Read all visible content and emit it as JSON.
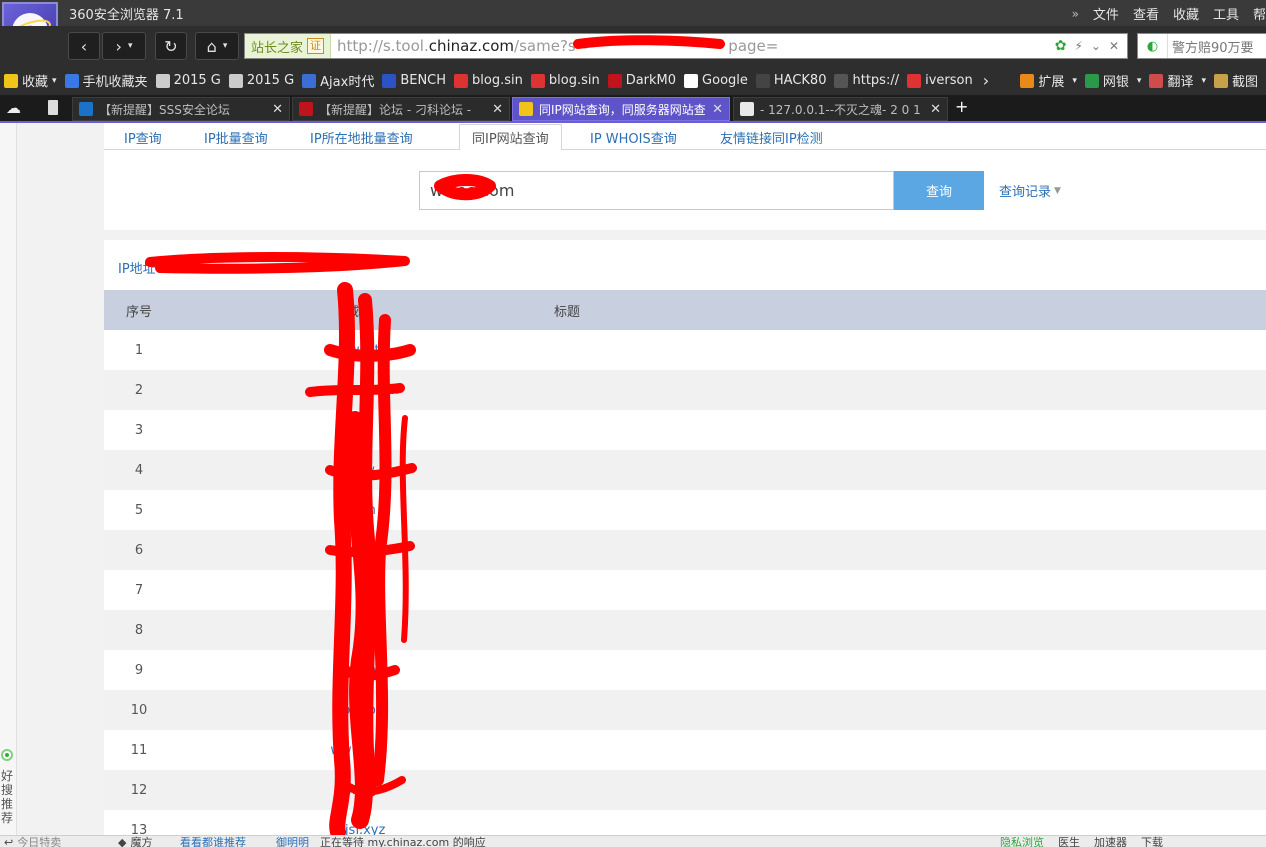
{
  "window": {
    "title": "360安全浏览器 7.1",
    "menu": [
      "文件",
      "查看",
      "收藏",
      "工具",
      "帮"
    ],
    "menu_chevron": "»"
  },
  "nav": {
    "site_badge": "站长之家",
    "site_badge_cert": "证",
    "url_prefix": "http://s.tool.",
    "url_host": "chinaz.com",
    "url_path": "/same?s=",
    "url_tail": "page=",
    "search_placeholder": "警方赔90万要"
  },
  "bookmarks": [
    {
      "label": "收藏",
      "icon": "star-icon"
    },
    {
      "label": "手机收藏夹",
      "icon": "phone-icon"
    },
    {
      "label": "2015 G",
      "icon": "l-icon"
    },
    {
      "label": "2015 G",
      "icon": "l-icon"
    },
    {
      "label": "Ajax时代",
      "icon": "ajax-icon"
    },
    {
      "label": "BENCH",
      "icon": "paw-icon"
    },
    {
      "label": "blog.sin",
      "icon": "blog-icon"
    },
    {
      "label": "blog.sin",
      "icon": "blog-icon"
    },
    {
      "label": "DarkM0",
      "icon": "skull-icon"
    },
    {
      "label": "Google",
      "icon": "google-icon"
    },
    {
      "label": "HACK80",
      "icon": "shield-icon"
    },
    {
      "label": "https://",
      "icon": "github-icon"
    },
    {
      "label": "iverson",
      "icon": "slc-icon"
    }
  ],
  "bookmarks_right": [
    {
      "label": "扩展",
      "icon": "puzzle-icon"
    },
    {
      "label": "网银",
      "icon": "bank-icon"
    },
    {
      "label": "翻译",
      "icon": "translate-icon"
    },
    {
      "label": "截图",
      "icon": "scissors-icon"
    }
  ],
  "tabs": [
    {
      "label": "【新提醒】SSS安全论坛",
      "icon": "sss-icon",
      "active": false
    },
    {
      "label": "【新提醒】论坛 - 刁科论坛 -",
      "icon": "slc-icon",
      "active": false
    },
    {
      "label": "同IP网站查询，同服务器网站查",
      "icon": "chinaz-icon",
      "active": true
    },
    {
      "label": "- 127.0.0.1--不灭之魂- 2 0 1",
      "icon": "page-icon",
      "active": false
    }
  ],
  "tool_tabs": [
    "IP查询",
    "IP批量查询",
    "IP所在地批量查询",
    "同IP网站查询",
    "IP WHOIS查询",
    "友情链接同IP检测"
  ],
  "query": {
    "input_value_visible": "w sec.com",
    "button": "查询",
    "history": "查询记录"
  },
  "result": {
    "ip_label": "IP地址：",
    "columns": [
      "序号",
      "域名",
      "标题"
    ],
    "rows": [
      {
        "no": "1",
        "domain": "www t"
      },
      {
        "no": "2",
        "domain": "xmch e.com"
      },
      {
        "no": "3",
        "domain": ""
      },
      {
        "no": "4",
        "domain": "www"
      },
      {
        "no": "5",
        "domain": "ww n"
      },
      {
        "no": "6",
        "domain": "www com"
      },
      {
        "no": "7",
        "domain": ""
      },
      {
        "no": "8",
        "domain": ""
      },
      {
        "no": "9",
        "domain": "ww .top"
      },
      {
        "no": "10",
        "domain": "b top"
      },
      {
        "no": "11",
        "domain": "ww .com"
      },
      {
        "no": "12",
        "domain": "w w"
      },
      {
        "no": "13",
        "domain": "fxjsf.xyz"
      }
    ]
  },
  "sidebar": {
    "text": "好搜推荐"
  },
  "status": {
    "left": "今日特卖",
    "item2": "魔方",
    "item3": "看看都谁推荐",
    "item4": "御明明",
    "loading": "正在等待 my.chinaz.com 的响应",
    "right": [
      "隐私浏览",
      "医生",
      "加速器",
      "下载"
    ]
  },
  "colors": {
    "chrome": "#2e2e2e",
    "active_tab": "#5e53c8",
    "link": "#2c6fb4",
    "search_button": "#5aa7e4",
    "table_header": "#c8d0df",
    "redaction": "#ff0000"
  }
}
